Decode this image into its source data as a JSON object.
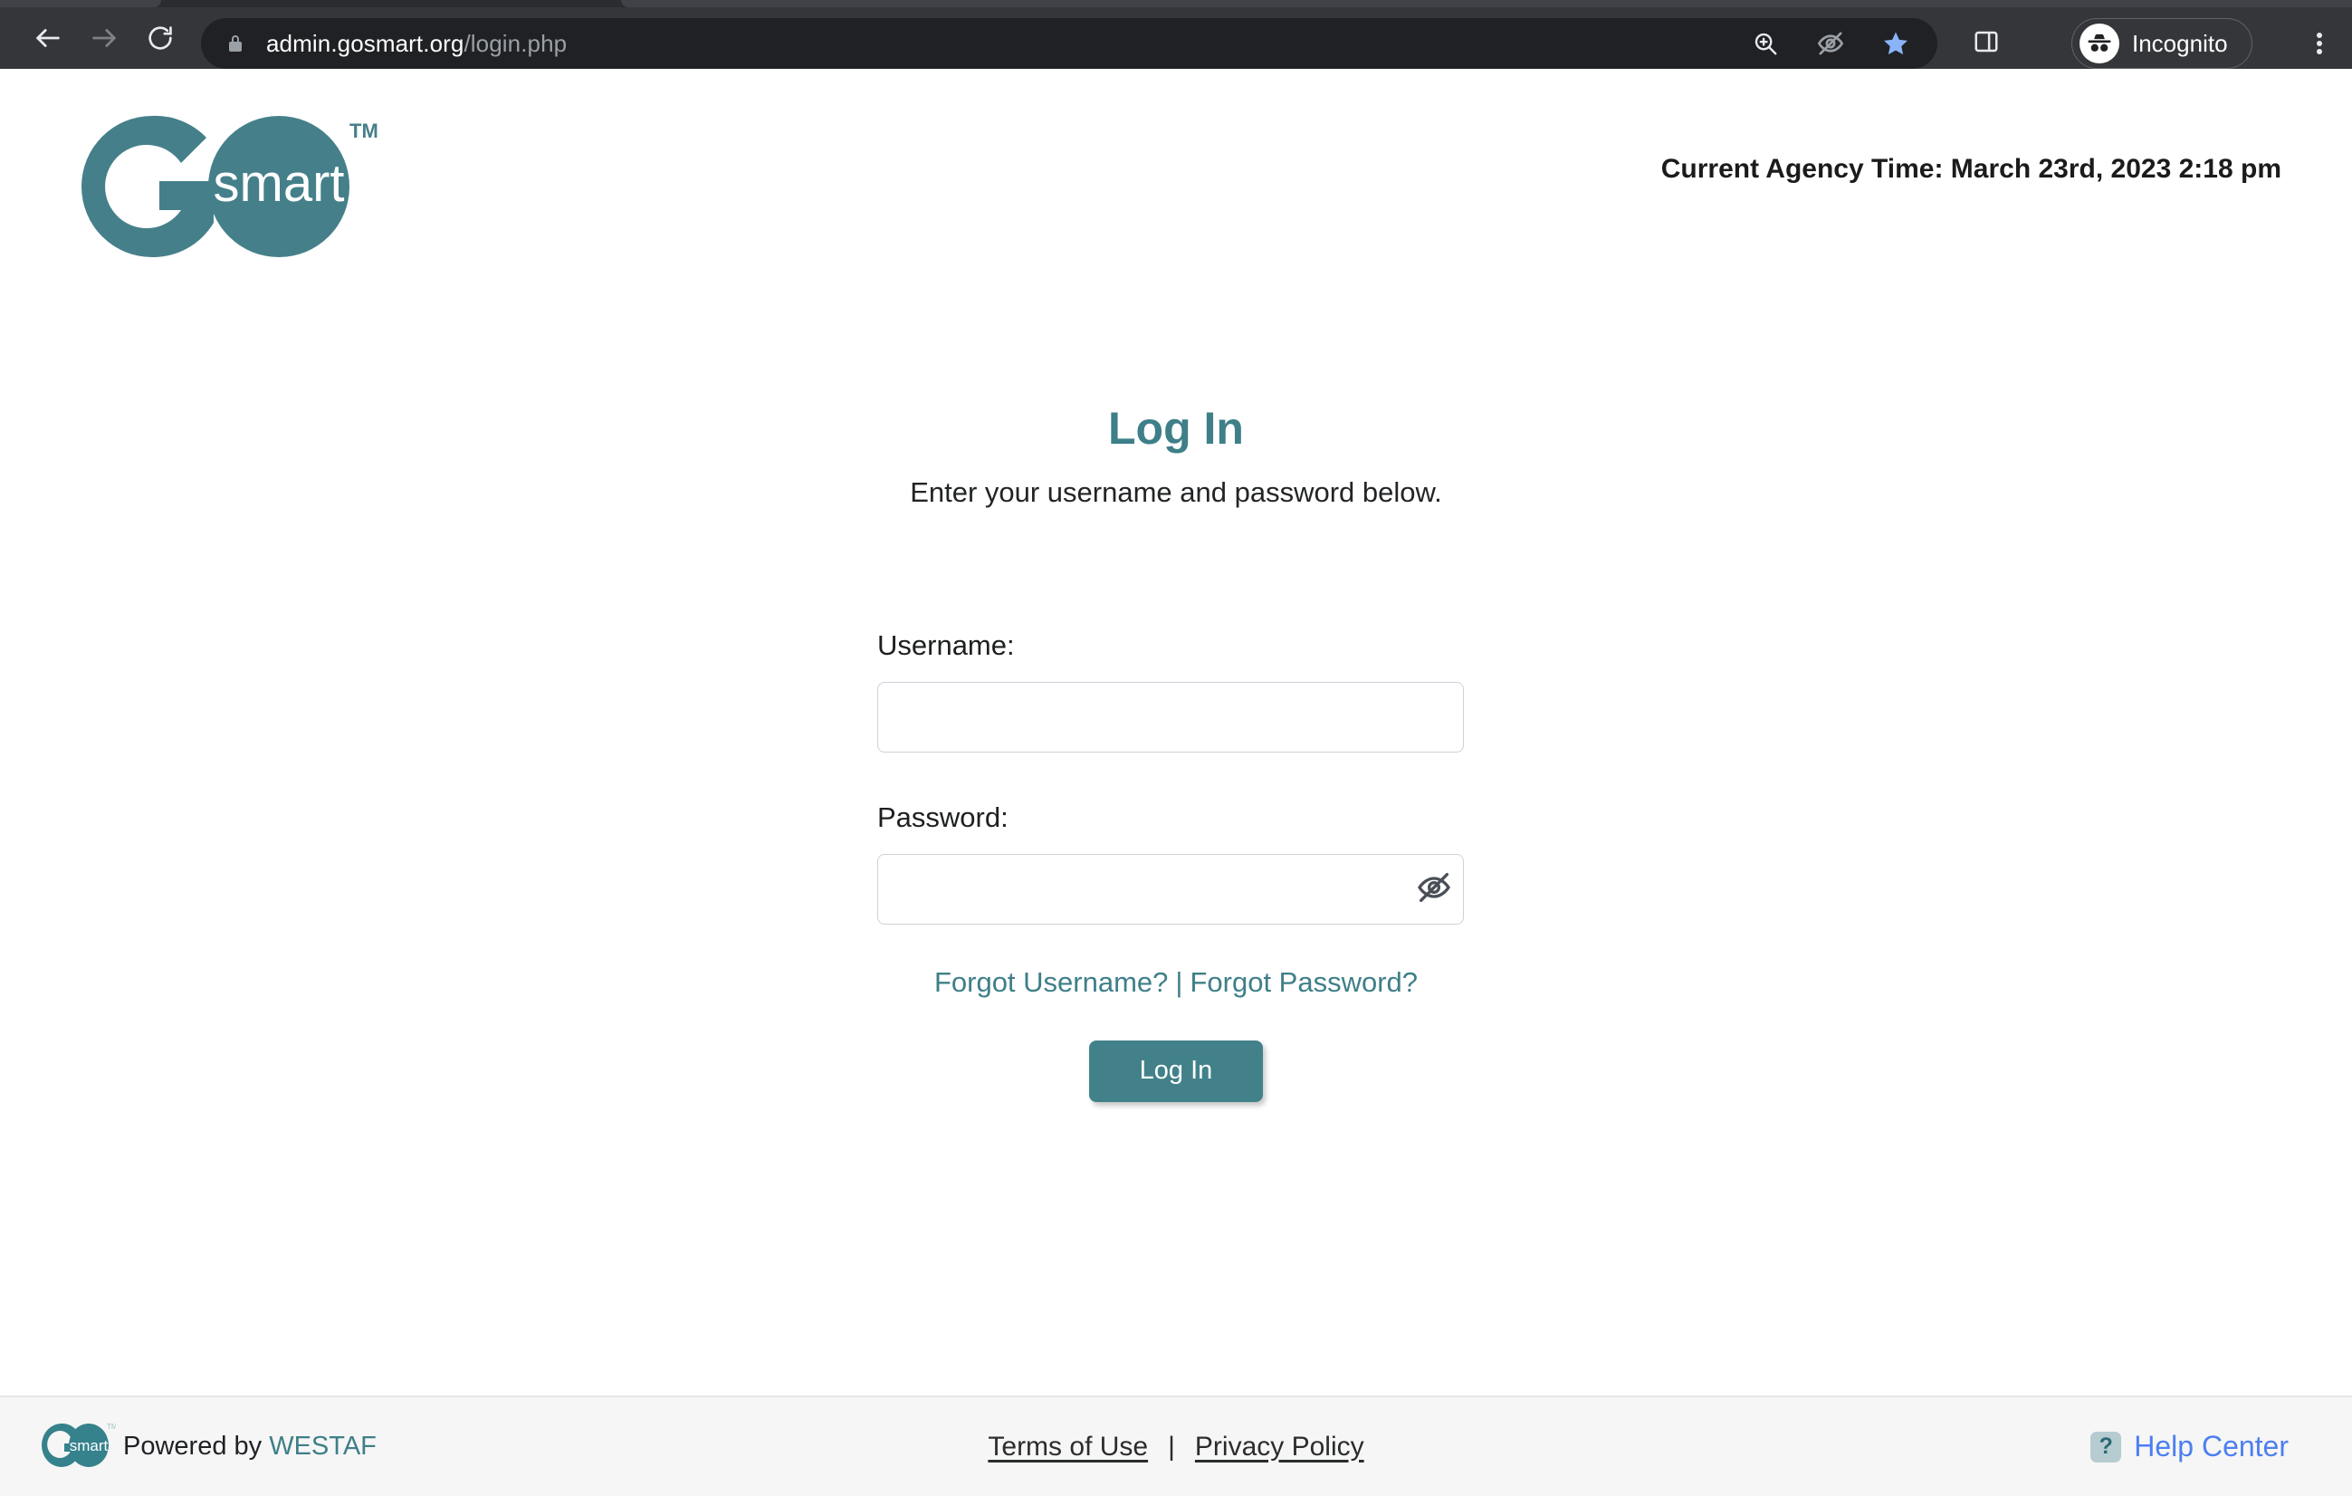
{
  "browser": {
    "url_domain": "admin.gosmart.org",
    "url_path": "/login.php",
    "profile_label": "Incognito",
    "icons": {
      "back": "back-arrow-icon",
      "forward": "forward-arrow-icon",
      "reload": "reload-icon",
      "lock": "lock-icon",
      "zoom": "zoom-in-icon",
      "tracking_off": "eye-off-icon",
      "bookmark": "star-icon",
      "side_panel": "side-panel-icon",
      "incognito": "incognito-icon",
      "menu": "three-dot-menu-icon"
    },
    "colors": {
      "chrome_bg": "#35363a",
      "omnibox_bg": "#202124",
      "star": "#8ab4f8"
    }
  },
  "header": {
    "logo_text_go": "G",
    "logo_text_smart": "smart",
    "logo_tm": "TM",
    "agency_time": "Current Agency Time: March 23rd, 2023 2:18 pm"
  },
  "login": {
    "title": "Log In",
    "subtitle": "Enter your username and password below.",
    "username_label": "Username:",
    "username_value": "",
    "username_placeholder": "",
    "password_label": "Password:",
    "password_value": "",
    "password_placeholder": "",
    "toggle_password_icon": "eye-off-icon",
    "forgot_username": "Forgot Username?",
    "link_separator": "|",
    "forgot_password": "Forgot Password?",
    "submit_label": "Log In"
  },
  "footer": {
    "powered_prefix": "Powered by ",
    "powered_brand": "WESTAF",
    "terms_label": "Terms of Use",
    "separator": "|",
    "privacy_label": "Privacy Policy",
    "help_badge": "?",
    "help_label": "Help Center"
  },
  "colors": {
    "teal": "#42818a",
    "heading_teal": "#3e7f88",
    "help_blue": "#4d7ff0",
    "footer_bg": "#f6f6f6",
    "input_border": "#ccd2d9"
  }
}
